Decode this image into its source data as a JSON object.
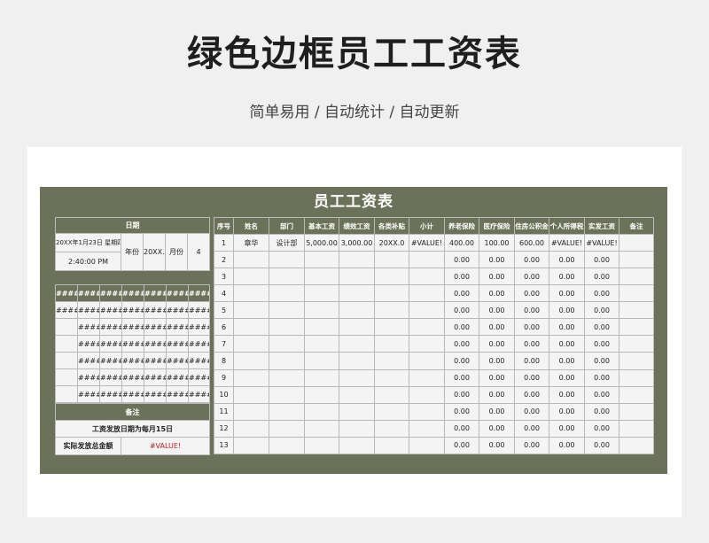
{
  "page": {
    "title": "绿色边框员工工资表",
    "subtitle": "简单易用 / 自动统计 / 自动更新"
  },
  "sheet": {
    "title": "员工工资表",
    "date_block": {
      "header": "日期",
      "date_text": "20XX年1月23日 星期四",
      "time_text": "2:40:00 PM",
      "year_label": "年份",
      "year_value": "20XX.0",
      "month_label": "月份",
      "month_value": "4"
    },
    "hash_grid": {
      "header_row": [
        "####",
        "####",
        "####",
        "####",
        "####",
        "####",
        "####"
      ],
      "rows": [
        [
          "#####",
          "#####",
          "#####",
          "#####",
          "#####",
          "#####",
          "#####"
        ],
        [
          "",
          "#####",
          "#####",
          "#####",
          "#####",
          "#####",
          "#####"
        ],
        [
          "",
          "#####",
          "#####",
          "#####",
          "#####",
          "#####",
          "#####"
        ],
        [
          "",
          "#####",
          "#####",
          "#####",
          "#####",
          "#####",
          "#####"
        ],
        [
          "",
          "#####",
          "#####",
          "#####",
          "#####",
          "#####",
          "#####"
        ],
        [
          "",
          "#####",
          "#####",
          "#####",
          "#####",
          "#####",
          "#####"
        ]
      ]
    },
    "notes": {
      "header": "备注",
      "pay_date_note": "工资发放日期为每月15日",
      "total_label": "实际发放总金额",
      "total_value": "#VALUE!"
    },
    "main_table": {
      "columns": [
        "序号",
        "姓名",
        "部门",
        "基本工资",
        "绩效工资",
        "各类补贴",
        "小计",
        "养老保险",
        "医疗保险",
        "住房公积金",
        "个人所得税",
        "实发工资",
        "备注"
      ],
      "rows": [
        [
          "1",
          "章华",
          "设计部",
          "5,000.00",
          "3,000.00",
          "20XX.0",
          "#VALUE!",
          "400.00",
          "100.00",
          "600.00",
          "#VALUE!",
          "#VALUE!",
          ""
        ],
        [
          "2",
          "",
          "",
          "",
          "",
          "",
          "",
          "0.00",
          "0.00",
          "0.00",
          "0.00",
          "0.00",
          ""
        ],
        [
          "3",
          "",
          "",
          "",
          "",
          "",
          "",
          "0.00",
          "0.00",
          "0.00",
          "0.00",
          "0.00",
          ""
        ],
        [
          "4",
          "",
          "",
          "",
          "",
          "",
          "",
          "0.00",
          "0.00",
          "0.00",
          "0.00",
          "0.00",
          ""
        ],
        [
          "5",
          "",
          "",
          "",
          "",
          "",
          "",
          "0.00",
          "0.00",
          "0.00",
          "0.00",
          "0.00",
          ""
        ],
        [
          "6",
          "",
          "",
          "",
          "",
          "",
          "",
          "0.00",
          "0.00",
          "0.00",
          "0.00",
          "0.00",
          ""
        ],
        [
          "7",
          "",
          "",
          "",
          "",
          "",
          "",
          "0.00",
          "0.00",
          "0.00",
          "0.00",
          "0.00",
          ""
        ],
        [
          "8",
          "",
          "",
          "",
          "",
          "",
          "",
          "0.00",
          "0.00",
          "0.00",
          "0.00",
          "0.00",
          ""
        ],
        [
          "9",
          "",
          "",
          "",
          "",
          "",
          "",
          "0.00",
          "0.00",
          "0.00",
          "0.00",
          "0.00",
          ""
        ],
        [
          "10",
          "",
          "",
          "",
          "",
          "",
          "",
          "0.00",
          "0.00",
          "0.00",
          "0.00",
          "0.00",
          ""
        ],
        [
          "11",
          "",
          "",
          "",
          "",
          "",
          "",
          "0.00",
          "0.00",
          "0.00",
          "0.00",
          "0.00",
          ""
        ],
        [
          "12",
          "",
          "",
          "",
          "",
          "",
          "",
          "0.00",
          "0.00",
          "0.00",
          "0.00",
          "0.00",
          ""
        ],
        [
          "13",
          "",
          "",
          "",
          "",
          "",
          "",
          "0.00",
          "0.00",
          "0.00",
          "0.00",
          "0.00",
          ""
        ]
      ]
    }
  },
  "colors": {
    "frame_green": "#6c7259",
    "error_red": "#b42222",
    "grid_line": "#b9b9b9"
  }
}
